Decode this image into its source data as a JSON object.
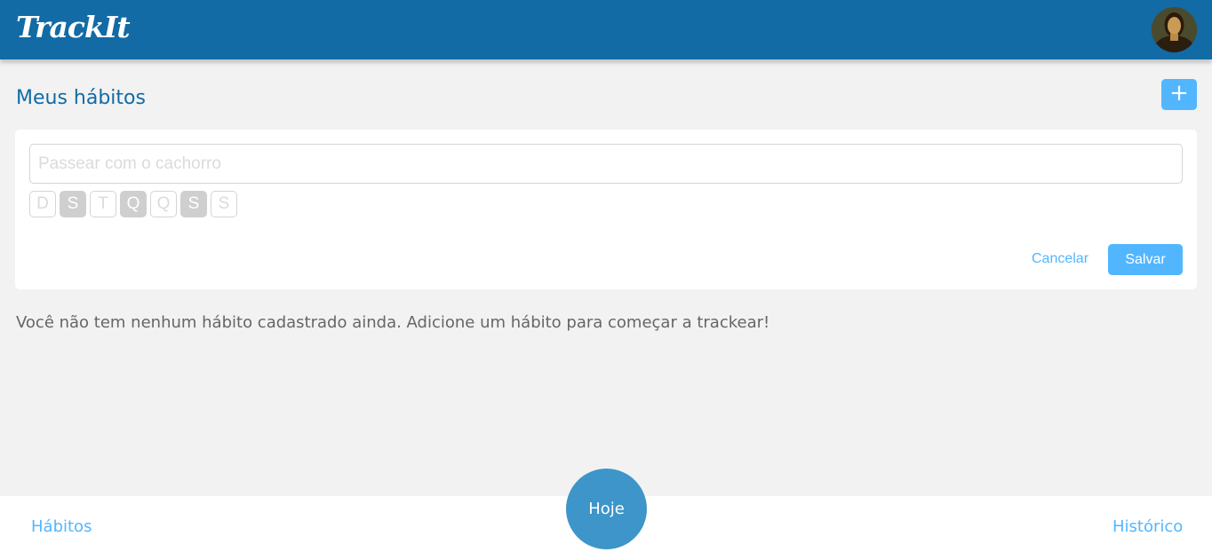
{
  "header": {
    "logo": "TrackIt",
    "avatar_icon": "user-avatar",
    "brand_color": "#126ba5"
  },
  "main": {
    "title": "Meus hábitos",
    "add_button_label": "+",
    "empty_message": "Você não tem nenhum hábito cadastrado ainda. Adicione um hábito para começar a trackear!"
  },
  "form": {
    "input_value": "",
    "input_placeholder": "Passear com o cachorro",
    "days": [
      {
        "label": "D",
        "selected": false
      },
      {
        "label": "S",
        "selected": true
      },
      {
        "label": "T",
        "selected": false
      },
      {
        "label": "Q",
        "selected": true
      },
      {
        "label": "Q",
        "selected": false
      },
      {
        "label": "S",
        "selected": true
      },
      {
        "label": "S",
        "selected": false
      }
    ],
    "cancel_label": "Cancelar",
    "save_label": "Salvar"
  },
  "footer": {
    "habits_label": "Hábitos",
    "today_label": "Hoje",
    "history_label": "Histórico"
  },
  "colors": {
    "accent": "#52b6ff",
    "today_button": "#3d95c9"
  }
}
